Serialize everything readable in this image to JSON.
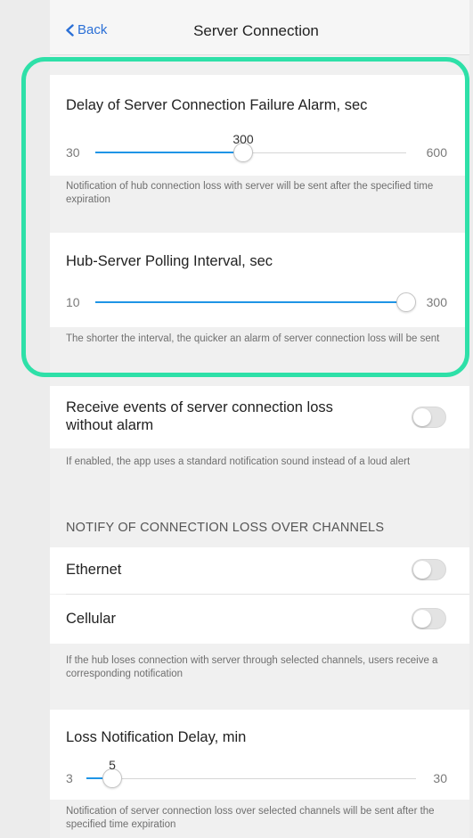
{
  "nav": {
    "back_label": "Back",
    "title": "Server Connection"
  },
  "delay_alarm": {
    "label": "Delay of Server Connection Failure Alarm, sec",
    "min": "30",
    "max": "600",
    "value": "300",
    "fraction": 0.474,
    "hint": "Notification of hub connection loss with server will be sent after the specified time expiration"
  },
  "polling": {
    "label": "Hub-Server Polling Interval, sec",
    "min": "10",
    "max": "300",
    "value": "300",
    "fraction": 1.0,
    "hint": "The shorter the interval, the quicker an alarm of server connection loss will be sent"
  },
  "receive_events": {
    "label": "Receive events of server connection loss without alarm",
    "enabled": false,
    "hint": "If enabled, the app uses a standard notification sound instead of a loud alert"
  },
  "channels": {
    "section_title": "NOTIFY OF CONNECTION LOSS OVER CHANNELS",
    "items": [
      {
        "label": "Ethernet",
        "enabled": false
      },
      {
        "label": "Cellular",
        "enabled": false
      }
    ],
    "hint": "If the hub loses connection with server through selected channels, users receive a corresponding notification"
  },
  "loss_delay": {
    "label": "Loss Notification Delay, min",
    "min": "3",
    "max": "30",
    "value": "5",
    "fraction": 0.074,
    "hint": "Notification of server connection loss over selected channels will be sent after the specified time expiration"
  },
  "colors": {
    "accent": "#1f95e6",
    "link": "#2a6fd6",
    "highlight": "#2ee0a8",
    "background": "#f0f0f0"
  }
}
